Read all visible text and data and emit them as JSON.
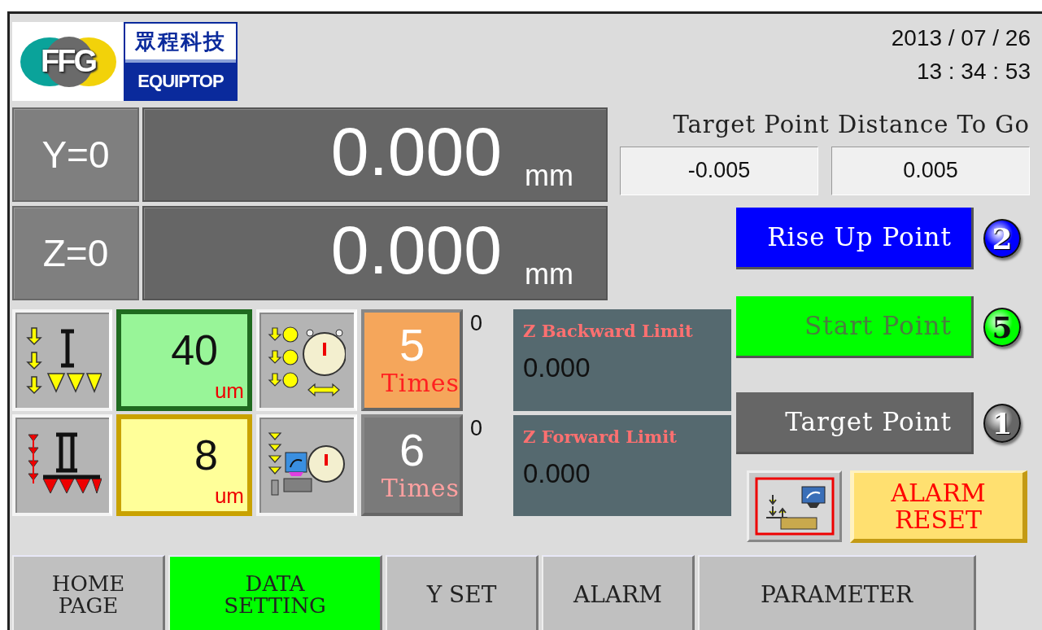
{
  "header": {
    "logo_mark": "FFG",
    "logo_chinese": "眾程科技",
    "logo_brand": "EQUIPTOP",
    "date": "2013 / 07 / 26",
    "time": "13 : 34 : 53"
  },
  "axes": [
    {
      "label": "Y=0",
      "value": "0.000",
      "unit": "mm"
    },
    {
      "label": "Z=0",
      "value": "0.000",
      "unit": "mm"
    }
  ],
  "target_distance": {
    "title": "Target Point Distance To Go",
    "values": [
      "-0.005",
      "0.005"
    ]
  },
  "point_buttons": [
    {
      "label": "Rise Up Point",
      "number": "2",
      "color": "#0000ff"
    },
    {
      "label": "Start Point",
      "number": "5",
      "color": "#00ff00"
    },
    {
      "label": "Target Point",
      "number": "1",
      "color": "#666666"
    }
  ],
  "steps": [
    {
      "kind": "stage-one",
      "value": "40",
      "unit": "um",
      "color": "#98f598",
      "times": {
        "value": "5",
        "label": "Times",
        "color": "#f5a65b"
      },
      "count": "0"
    },
    {
      "kind": "stage-two",
      "value": "8",
      "unit": "um",
      "color": "#ffff99",
      "times": {
        "value": "6",
        "label": "Times",
        "color": "#7a7a7a"
      },
      "count": "0"
    }
  ],
  "limits": [
    {
      "label": "Z Backward Limit",
      "value": "0.000"
    },
    {
      "label": "Z Forward Limit",
      "value": "0.000"
    }
  ],
  "alarm_reset": {
    "lines": [
      "ALARM",
      "RESET"
    ]
  },
  "tabs": [
    {
      "lines": [
        "HOME",
        "PAGE"
      ],
      "selected": false
    },
    {
      "lines": [
        "DATA",
        "SETTING"
      ],
      "selected": true
    },
    {
      "lines": [
        "Y SET"
      ],
      "selected": false
    },
    {
      "lines": [
        "ALARM"
      ],
      "selected": false
    },
    {
      "lines": [
        "PARAMETER"
      ],
      "selected": false
    }
  ]
}
